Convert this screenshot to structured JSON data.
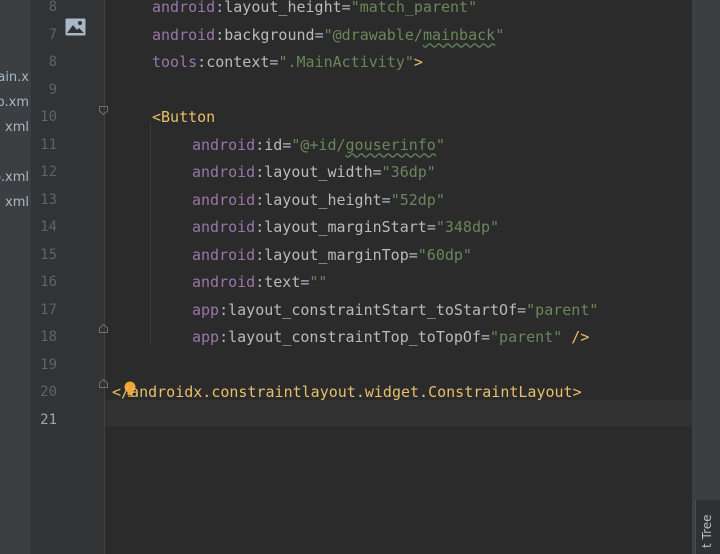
{
  "project_panel": {
    "files": [
      "main.x",
      "fo.xm",
      "xml",
      "o.xml",
      "xml"
    ]
  },
  "tool_window": {
    "label": "t Tree"
  },
  "editor": {
    "lines": [
      {
        "num": "8",
        "indent": 4,
        "segments": [
          {
            "t": "ns",
            "v": "android"
          },
          {
            "t": "punct",
            "v": ":"
          },
          {
            "t": "attr",
            "v": "layout_height"
          },
          {
            "t": "punct",
            "v": "="
          },
          {
            "t": "val",
            "v": "\"match_parent\""
          }
        ]
      },
      {
        "num": "7",
        "indent": 4,
        "segments": [
          {
            "t": "ns",
            "v": "android"
          },
          {
            "t": "punct",
            "v": ":"
          },
          {
            "t": "attr",
            "v": "background"
          },
          {
            "t": "punct",
            "v": "="
          },
          {
            "t": "val",
            "v": "\"@drawable/"
          },
          {
            "t": "valwavy",
            "v": "mainback"
          },
          {
            "t": "val",
            "v": "\""
          }
        ]
      },
      {
        "num": "8",
        "indent": 4,
        "segments": [
          {
            "t": "ns",
            "v": "tools"
          },
          {
            "t": "punct",
            "v": ":"
          },
          {
            "t": "attr",
            "v": "context"
          },
          {
            "t": "punct",
            "v": "="
          },
          {
            "t": "val",
            "v": "\".MainActivity\""
          },
          {
            "t": "tag",
            "v": ">"
          }
        ]
      },
      {
        "num": "9",
        "indent": 0,
        "segments": []
      },
      {
        "num": "10",
        "indent": 4,
        "segments": [
          {
            "t": "tag",
            "v": "<Button"
          }
        ]
      },
      {
        "num": "11",
        "indent": 8,
        "segments": [
          {
            "t": "ns",
            "v": "android"
          },
          {
            "t": "punct",
            "v": ":"
          },
          {
            "t": "attr",
            "v": "id"
          },
          {
            "t": "punct",
            "v": "="
          },
          {
            "t": "val",
            "v": "\"@+id/"
          },
          {
            "t": "valwavy",
            "v": "gouserinfo"
          },
          {
            "t": "val",
            "v": "\""
          }
        ]
      },
      {
        "num": "12",
        "indent": 8,
        "segments": [
          {
            "t": "ns",
            "v": "android"
          },
          {
            "t": "punct",
            "v": ":"
          },
          {
            "t": "attr",
            "v": "layout_width"
          },
          {
            "t": "punct",
            "v": "="
          },
          {
            "t": "val",
            "v": "\"36dp\""
          }
        ]
      },
      {
        "num": "13",
        "indent": 8,
        "segments": [
          {
            "t": "ns",
            "v": "android"
          },
          {
            "t": "punct",
            "v": ":"
          },
          {
            "t": "attr",
            "v": "layout_height"
          },
          {
            "t": "punct",
            "v": "="
          },
          {
            "t": "val",
            "v": "\"52dp\""
          }
        ]
      },
      {
        "num": "14",
        "indent": 8,
        "segments": [
          {
            "t": "ns",
            "v": "android"
          },
          {
            "t": "punct",
            "v": ":"
          },
          {
            "t": "attr",
            "v": "layout_marginStart"
          },
          {
            "t": "punct",
            "v": "="
          },
          {
            "t": "val",
            "v": "\"348dp\""
          }
        ]
      },
      {
        "num": "15",
        "indent": 8,
        "segments": [
          {
            "t": "ns",
            "v": "android"
          },
          {
            "t": "punct",
            "v": ":"
          },
          {
            "t": "attr",
            "v": "layout_marginTop"
          },
          {
            "t": "punct",
            "v": "="
          },
          {
            "t": "val",
            "v": "\"60dp\""
          }
        ]
      },
      {
        "num": "16",
        "indent": 8,
        "segments": [
          {
            "t": "ns",
            "v": "android"
          },
          {
            "t": "punct",
            "v": ":"
          },
          {
            "t": "attr",
            "v": "text"
          },
          {
            "t": "punct",
            "v": "="
          },
          {
            "t": "val",
            "v": "\"\""
          }
        ]
      },
      {
        "num": "17",
        "indent": 8,
        "segments": [
          {
            "t": "ns",
            "v": "app"
          },
          {
            "t": "punct",
            "v": ":"
          },
          {
            "t": "attr",
            "v": "layout_constraintStart_toStartOf"
          },
          {
            "t": "punct",
            "v": "="
          },
          {
            "t": "val",
            "v": "\"parent\""
          }
        ]
      },
      {
        "num": "18",
        "indent": 8,
        "segments": [
          {
            "t": "ns",
            "v": "app"
          },
          {
            "t": "punct",
            "v": ":"
          },
          {
            "t": "attr",
            "v": "layout_constraintTop_toTopOf"
          },
          {
            "t": "punct",
            "v": "="
          },
          {
            "t": "val",
            "v": "\"parent\""
          },
          {
            "t": "tag",
            "v": " />"
          }
        ]
      },
      {
        "num": "19",
        "indent": 0,
        "segments": []
      },
      {
        "num": "20",
        "indent": 0,
        "segments": [
          {
            "t": "tag",
            "v": "</androidx.constraintlayout.widget.ConstraintLayout>"
          }
        ]
      },
      {
        "num": "21",
        "indent": 0,
        "segments": [],
        "current": true
      }
    ]
  },
  "colors": {
    "tag": "#e8bf6a",
    "ns": "#9876aa",
    "attr": "#bababa",
    "val": "#6a8759",
    "punct": "#a9b7c6"
  }
}
